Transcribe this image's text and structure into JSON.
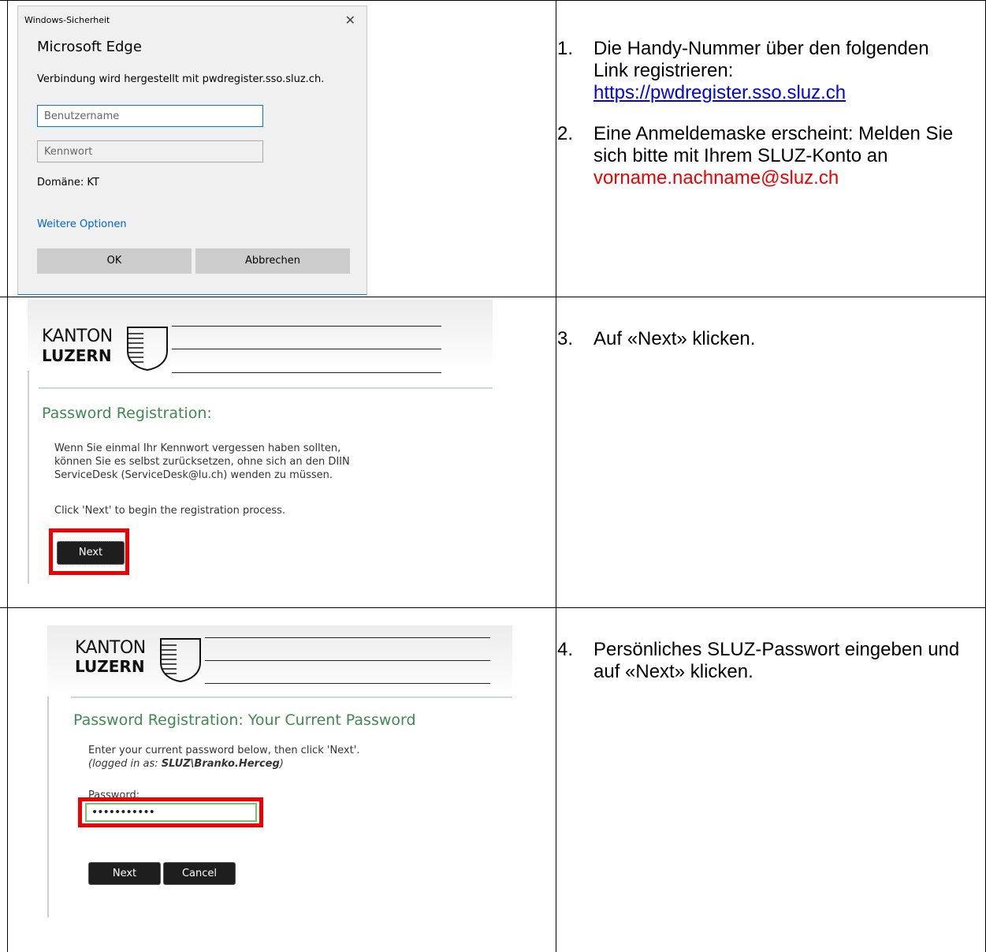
{
  "steps": {
    "s1": {
      "num": "1.",
      "text": "Die Handy-Nummer über den folgenden Link registrieren:",
      "link": "https://pwdregister.sso.sluz.ch"
    },
    "s2": {
      "num": "2.",
      "text": "Eine Anmeldemaske erscheint: Melden Sie sich bitte mit Ihrem SLUZ-Konto an",
      "email": "vorname.nachname@sluz.ch"
    },
    "s3": {
      "num": "3.",
      "text": "Auf «Next» klicken."
    },
    "s4": {
      "num": "4.",
      "text": "Persönliches SLUZ-Passwort eingeben und auf «Next» klicken."
    }
  },
  "dialog": {
    "caption": "Windows-Sicherheit",
    "close": "✕",
    "app": "Microsoft Edge",
    "message": "Verbindung wird hergestellt mit pwdregister.sso.sluz.ch.",
    "username_placeholder": "Benutzername",
    "password_placeholder": "Kennwort",
    "domain": "Domäne: KT",
    "more_options": "Weitere Optionen",
    "ok": "OK",
    "cancel": "Abbrechen"
  },
  "logo": {
    "line1": "KANTON",
    "line2": "LUZERN"
  },
  "page1": {
    "title": "Password Registration:",
    "para": "Wenn Sie einmal Ihr Kennwort vergessen haben sollten, können Sie es selbst zurücksetzen, ohne sich an den DIIN ServiceDesk (ServiceDesk@lu.ch) wenden zu müssen.",
    "hint": "Click 'Next' to begin the registration process.",
    "next": "Next"
  },
  "page2": {
    "title": "Password Registration:  Your Current Password",
    "para": "Enter your current password below, then click 'Next'.",
    "logged_prefix": "(logged in as: ",
    "logged_user": "SLUZ\\Branko.Herceg",
    "logged_suffix": ")",
    "pwd_label": "Password:",
    "pwd_value": "•••••••••••",
    "next": "Next",
    "cancel": "Cancel"
  }
}
